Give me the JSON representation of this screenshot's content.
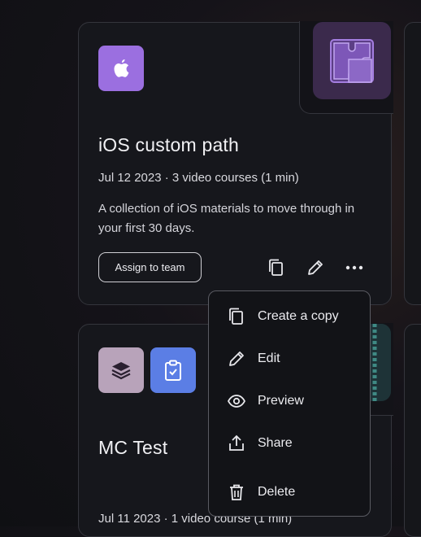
{
  "cards": [
    {
      "title": "iOS custom path",
      "meta": "Jul 12 2023 · 3 video courses (1 min)",
      "description": "A collection of iOS materials to move through in your first 30 days.",
      "assign_label": "Assign to team",
      "badge_color": "#9b6fe0"
    },
    {
      "title": "MC Test",
      "meta": "Jul 11 2023 · 1 video course (1 min)",
      "badge_colors": [
        "#b8a3ba",
        "#5b7ee5"
      ]
    }
  ],
  "context_menu": {
    "items": [
      {
        "label": "Create a copy",
        "icon": "copy-icon"
      },
      {
        "label": "Edit",
        "icon": "pencil-icon"
      },
      {
        "label": "Preview",
        "icon": "eye-icon"
      },
      {
        "label": "Share",
        "icon": "share-icon"
      },
      {
        "label": "Delete",
        "icon": "trash-icon"
      }
    ]
  }
}
